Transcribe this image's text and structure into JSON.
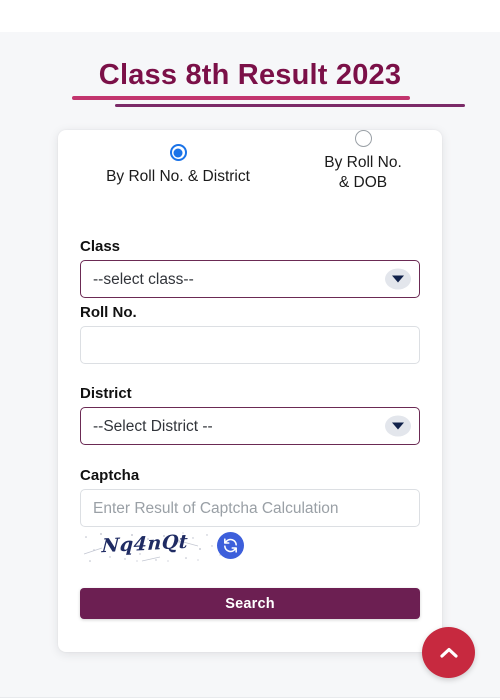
{
  "page": {
    "title": "Class 8th Result 2023",
    "accent_title": "#7b1048",
    "accent_rule_top": "#c2356e",
    "accent_rule_bottom": "#7b2a68",
    "accent_button": "#6c1f52",
    "accent_radio": "#1a73e8",
    "accent_refresh": "#3d5fdb",
    "accent_scrolltop": "#c7293f"
  },
  "form": {
    "search_modes": [
      {
        "label": "By Roll No. & District",
        "selected": true,
        "icon": "radio-selected-icon"
      },
      {
        "label": "By Roll No.\n& DOB",
        "selected": false,
        "icon": "radio-unselected-icon"
      }
    ],
    "class_field": {
      "label": "Class",
      "value": "--select class--",
      "icon": "chevron-down-icon"
    },
    "roll_field": {
      "label": "Roll No.",
      "value": "",
      "placeholder": ""
    },
    "district_field": {
      "label": "District",
      "value": "--Select District --",
      "icon": "chevron-down-icon"
    },
    "captcha_field": {
      "label": "Captcha",
      "value": "",
      "placeholder": "Enter Result of Captcha Calculation",
      "image_text": "Nq4nQt",
      "refresh_icon": "refresh-icon"
    },
    "search_button": "Search"
  },
  "scroll_top": {
    "icon": "chevron-up-icon",
    "label": "Back to top"
  }
}
